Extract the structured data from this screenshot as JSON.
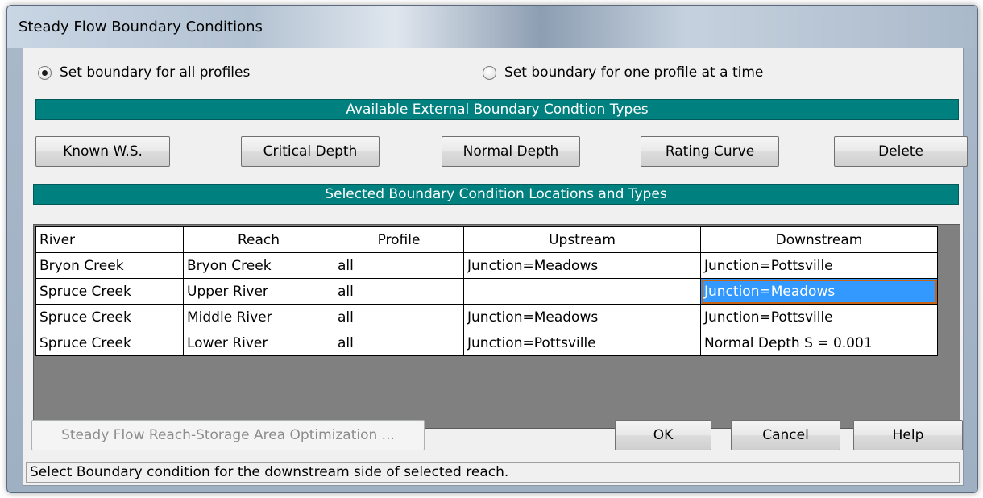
{
  "window": {
    "title": "Steady Flow Boundary Conditions"
  },
  "options": {
    "all_profiles_label": "Set boundary for all profiles",
    "one_profile_label": "Set boundary for one profile at a time",
    "selected": "all_profiles"
  },
  "available_header": "Available External Boundary Condtion Types",
  "type_buttons": {
    "known_ws": "Known W.S.",
    "critical_depth": "Critical Depth",
    "normal_depth": "Normal Depth",
    "rating_curve": "Rating Curve",
    "delete": "Delete"
  },
  "locations_header": "Selected Boundary Condition Locations and Types",
  "table": {
    "columns": [
      "River",
      "Reach",
      "Profile",
      "Upstream",
      "Downstream"
    ],
    "rows": [
      [
        "Bryon Creek",
        "Bryon Creek",
        "all",
        "Junction=Meadows",
        "Junction=Pottsville"
      ],
      [
        "Spruce Creek",
        "Upper River",
        "all",
        "",
        "Junction=Meadows"
      ],
      [
        "Spruce Creek",
        "Middle River",
        "all",
        "Junction=Meadows",
        "Junction=Pottsville"
      ],
      [
        "Spruce Creek",
        "Lower River",
        "all",
        "Junction=Pottsville",
        "Normal Depth S = 0.001"
      ]
    ],
    "selected_cell": {
      "row": 1,
      "column": "Downstream"
    }
  },
  "bottom_buttons": {
    "optimization": "Steady Flow Reach-Storage Area Optimization ...",
    "ok": "OK",
    "cancel": "Cancel",
    "help": "Help"
  },
  "status_text": "Select Boundary condition for the downstream side of selected reach.",
  "colors": {
    "section_header": "#00807f",
    "selection": "#3399ff",
    "selection_border": "#c86414",
    "grid_background": "#808080"
  }
}
